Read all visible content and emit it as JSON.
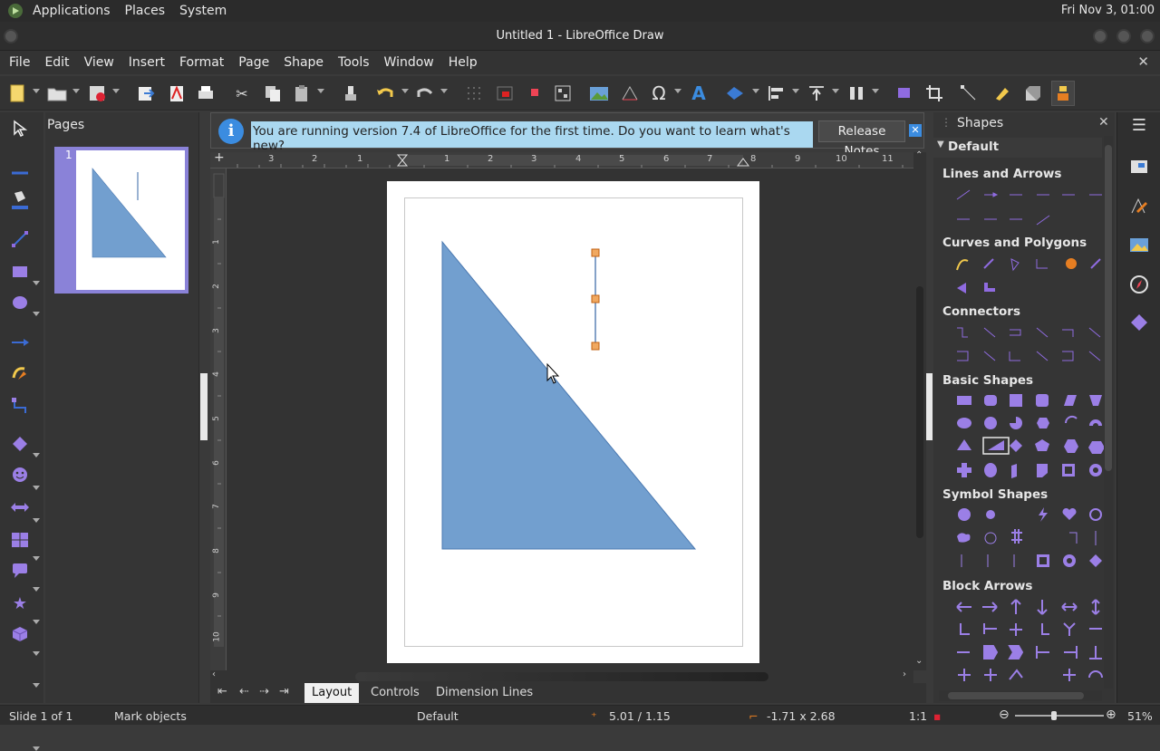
{
  "topbar": {
    "menus": [
      "Applications",
      "Places",
      "System"
    ],
    "clock": "Fri Nov 3, 01:00"
  },
  "window": {
    "title": "Untitled 1 - LibreOffice Draw"
  },
  "menubar": [
    "File",
    "Edit",
    "View",
    "Insert",
    "Format",
    "Page",
    "Shape",
    "Tools",
    "Window",
    "Help"
  ],
  "pages_panel": {
    "title": "Pages",
    "page_number": "1"
  },
  "infobar": {
    "message": "You are running version 7.4 of LibreOffice for the first time. Do you want to learn what's new?",
    "button": "Release Notes"
  },
  "ruler": {
    "h_labels": [
      "3",
      "2",
      "1",
      "1",
      "2",
      "3",
      "4",
      "5",
      "6",
      "7",
      "8",
      "9",
      "10",
      "11"
    ],
    "v_labels": [
      "1",
      "2",
      "3",
      "4",
      "5",
      "6",
      "7",
      "8",
      "9",
      "10"
    ]
  },
  "tabs": [
    "Layout",
    "Controls",
    "Dimension Lines"
  ],
  "shapes_panel": {
    "title": "Shapes",
    "group": "Default",
    "sections": [
      "Lines and Arrows",
      "Curves and Polygons",
      "Connectors",
      "Basic Shapes",
      "Symbol Shapes",
      "Block Arrows"
    ]
  },
  "statusbar": {
    "slide": "Slide 1 of 1",
    "mode": "Mark objects",
    "layout": "Default",
    "position": "5.01 / 1.15",
    "size": "-1.71 x 2.68",
    "scale": "1:1",
    "zoom": "51%"
  },
  "colors": {
    "shape_fill": "#729fcf",
    "accent": "#9b7fe6",
    "infobar_bg": "#aad8f0"
  }
}
